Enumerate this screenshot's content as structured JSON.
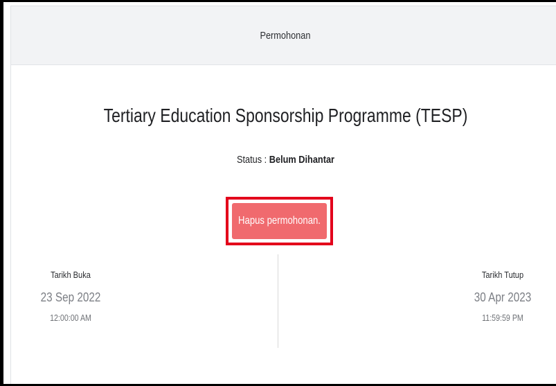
{
  "header": {
    "title": "Permohonan"
  },
  "application": {
    "title": "Tertiary Education Sponsorship Programme (TESP)",
    "status_label": "Status :",
    "status_value": "Belum Dihantar",
    "delete_button_label": "Hapus permohonan."
  },
  "dates": {
    "open": {
      "label": "Tarikh Buka",
      "date": "23 Sep 2022",
      "time": "12:00:00 AM"
    },
    "close": {
      "label": "Tarikh Tutup",
      "date": "30 Apr 2023",
      "time": "11:59:59 PM"
    }
  },
  "colors": {
    "delete_button": "#f06a6e",
    "highlight_border": "#e3001b",
    "header_background": "#f2f3f5",
    "muted_text": "#7c7f85"
  }
}
